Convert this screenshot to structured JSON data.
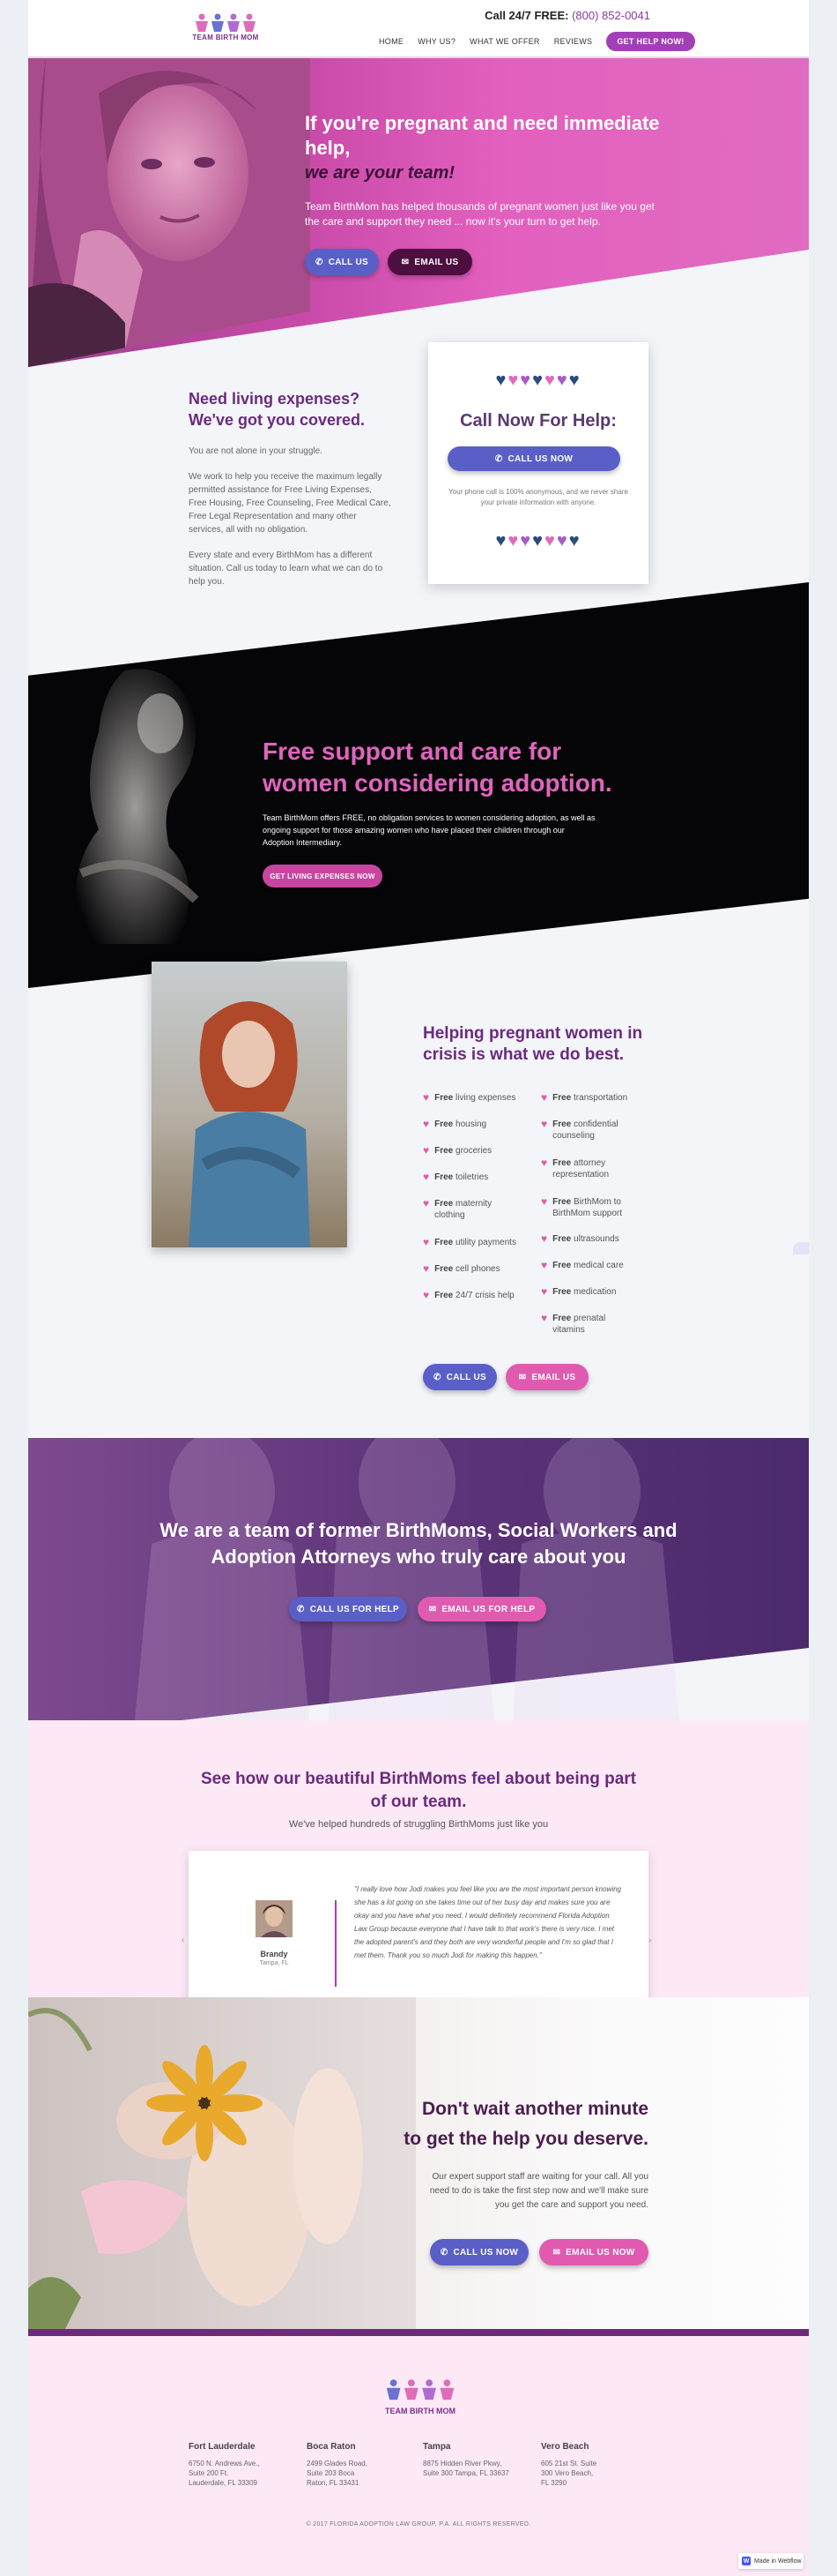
{
  "header": {
    "logo_text": "TEAM BIRTH MOM",
    "phone_label": "Call 24/7 FREE:",
    "phone_number": "(800) 852-0041",
    "nav": [
      "HOME",
      "WHY US?",
      "WHAT WE OFFER",
      "REVIEWS"
    ],
    "cta": "GET HELP NOW!"
  },
  "hero": {
    "title": "If you're pregnant and need immediate help,",
    "title_em": "we are your team!",
    "subtitle": "Team BirthMom has helped thousands of pregnant women just like you get the care and support they need ... now it's your turn to get help.",
    "call_btn": "CALL US",
    "email_btn": "EMAIL US"
  },
  "living": {
    "title": "Need living expenses? We've got you covered.",
    "p1": "You are not alone in your struggle.",
    "p2": "We work to help you receive the maximum legally permitted assistance for Free Living Expenses, Free Housing, Free Counseling, Free Medical Care, Free Legal Representation and many other services, all with no obligation.",
    "p3": "Every state and every BirthMom has a different situation. Call us today to learn what we can do to help you."
  },
  "callcard": {
    "hearts": "♥♥♥♥♥♥♥",
    "title": "Call Now For Help:",
    "button": "CALL US NOW",
    "note": "Your phone call is 100% anonymous, and we never share your private information with anyone."
  },
  "adoption": {
    "title": "Free support and care for women considering adoption.",
    "text": "Team BirthMom offers FREE, no obligation services to women considering adoption, as well as ongoing support for those amazing women who have placed their children through our Adoption Intermediary.",
    "button": "GET LIVING EXPENSES NOW"
  },
  "crisis": {
    "title": "Helping pregnant women in crisis is what we do best.",
    "left_items": [
      {
        "free": "Free",
        "rest": "living expenses"
      },
      {
        "free": "Free",
        "rest": "housing"
      },
      {
        "free": "Free",
        "rest": "groceries"
      },
      {
        "free": "Free",
        "rest": "toiletries"
      },
      {
        "free": "Free",
        "rest": "maternity clothing"
      },
      {
        "free": "Free",
        "rest": "utility payments"
      },
      {
        "free": "Free",
        "rest": "cell phones"
      },
      {
        "free": "Free",
        "rest": "24/7 crisis help"
      }
    ],
    "right_items": [
      {
        "free": "Free",
        "rest": "transportation"
      },
      {
        "free": "Free",
        "rest": "confidential counseling"
      },
      {
        "free": "Free",
        "rest": "attorney representation"
      },
      {
        "free": "Free",
        "rest": "BirthMom to BirthMom support"
      },
      {
        "free": "Free",
        "rest": "ultrasounds"
      },
      {
        "free": "Free",
        "rest": "medical care"
      },
      {
        "free": "Free",
        "rest": "medication"
      },
      {
        "free": "Free",
        "rest": "prenatal vitamins"
      }
    ],
    "call_btn": "CALL US",
    "email_btn": "EMAIL US"
  },
  "team": {
    "title": "We are a team of former BirthMoms, Social Workers and Adoption Attorneys who truly care about you",
    "call_btn": "CALL US FOR HELP",
    "email_btn": "EMAIL US FOR HELP"
  },
  "testimonials": {
    "title": "See how our beautiful BirthMoms feel about being part of our team.",
    "subtitle": "We've helped hundreds of struggling BirthMoms just like you",
    "name": "Brandy",
    "city": "Tampa, FL",
    "quote": "\"I really love how Jodi makes you feel like you are the most important person knowing she has a lot going on she takes time out of her busy day and makes sure you are okay and you have what you need. I would definitely recommend Florida Adoption Law Group because everyone that I have talk to that work's there is very nice. I met the adopted parent's and they both are very wonderful people and I'm so glad that I met them. Thank you so much Jodi for making this happen.\""
  },
  "wait": {
    "title1": "Don't wait another minute",
    "title2": "to get the help you deserve.",
    "text": "Our expert support staff are waiting for your call. All you need to do is take the first step now and we'll make sure you get the care and support you need.",
    "call_btn": "CALL US NOW",
    "email_btn": "EMAIL US NOW"
  },
  "footer": {
    "logo_text": "TEAM BIRTH MOM",
    "offices": [
      {
        "city": "Fort Lauderdale",
        "address": "6750 N. Andrews Ave., Suite 200 Ft. Lauderdale, FL 33309"
      },
      {
        "city": "Boca Raton",
        "address": "2499 Glades Road, Suite 203 Boca Raton, FL 33431"
      },
      {
        "city": "Tampa",
        "address": "8875 Hidden River Pkwy, Suite 300 Tampa, FL 33637"
      },
      {
        "city": "Vero Beach",
        "address": "605 21st St. Suite 300 Vero Beach, FL 3290"
      }
    ],
    "copyright": "© 2017 FLORIDA ADOPTION LAW GROUP, P.A. ALL RIGHTS RESERVED.",
    "badge": "Made in Webflow"
  },
  "colors": {
    "brand_purple": "#6b2a7f",
    "accent_pink": "#e05aaf",
    "button_blue": "#5a5fc7",
    "heart_navy": "#2c4a7a"
  }
}
